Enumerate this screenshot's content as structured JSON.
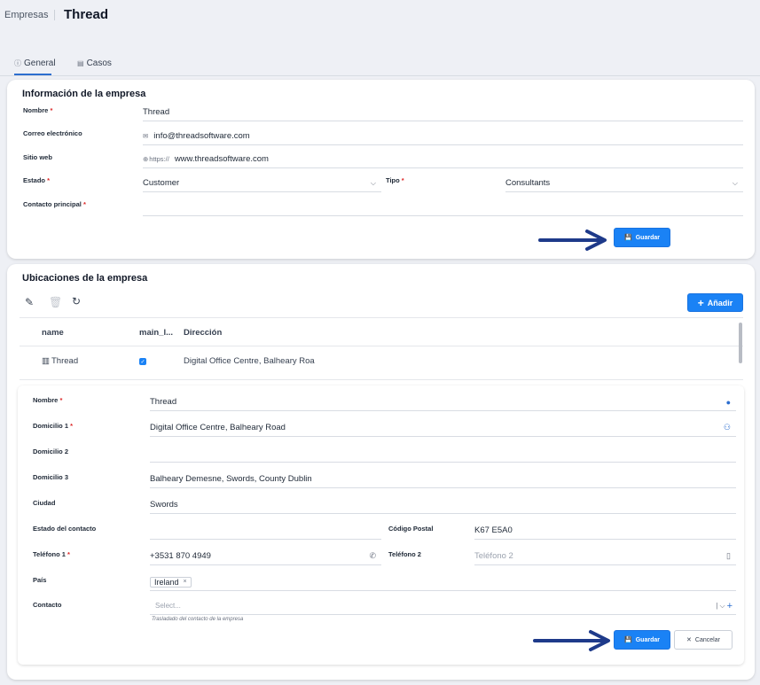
{
  "breadcrumb": {
    "parent": "Empresas",
    "title": "Thread"
  },
  "tabs": [
    {
      "label": "General",
      "icon": "info-icon"
    },
    {
      "label": "Casos",
      "icon": "cases-icon"
    }
  ],
  "company": {
    "section_title": "Información de la empresa",
    "name_label": "Nombre",
    "name_value": "Thread",
    "email_label": "Correo electrónico",
    "email_value": "info@threadsoftware.com",
    "website_label": "Sitio web",
    "website_prefix": "https://",
    "website_value": "www.threadsoftware.com",
    "state_label": "Estado",
    "state_value": "Customer",
    "type_label": "Tipo",
    "type_value": "Consultants",
    "contact_label": "Contacto principal",
    "contact_value": "",
    "save_label": "Guardar"
  },
  "locations": {
    "section_title": "Ubicaciones de la empresa",
    "add_label": "Añadir",
    "columns": [
      "name",
      "main_l...",
      "Dirección"
    ],
    "rows": [
      {
        "name": "Thread",
        "main": true,
        "address": "Digital Office Centre, Balheary Roa"
      }
    ],
    "form": {
      "name_label": "Nombre",
      "name_value": "Thread",
      "address1_label": "Domicilio 1",
      "address1_value": "Digital Office Centre, Balheary Road",
      "address2_label": "Domicilio 2",
      "address2_value": "",
      "address3_label": "Domicilio 3",
      "address3_value": "Balheary Demesne, Swords, County Dublin",
      "city_label": "Ciudad",
      "city_value": "Swords",
      "contact_state_label": "Estado del contacto",
      "contact_state_value": "",
      "postal_label": "Código Postal",
      "postal_value": "K67 E5A0",
      "phone1_label": "Teléfono 1",
      "phone1_value": "+3531 870 4949",
      "phone2_label": "Teléfono 2",
      "phone2_placeholder": "Teléfono 2",
      "country_label": "País",
      "country_value": "Ireland",
      "contact_label": "Contacto",
      "contact_placeholder": "Select...",
      "contact_hint": "Trasladado del contacto de la empresa",
      "save_label": "Guardar",
      "cancel_label": "Cancelar"
    }
  },
  "colors": {
    "accent": "#1a82f5",
    "arrow": "#1e3a8a",
    "required": "#dc2626"
  }
}
